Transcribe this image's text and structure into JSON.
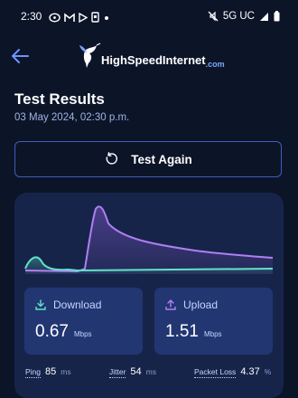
{
  "status_bar": {
    "time": "2:30",
    "network": "5G UC",
    "icons": [
      "whatsapp-icon",
      "gmail-icon",
      "play-store-icon",
      "sim-icon",
      "dot-icon",
      "mute-icon",
      "signal-icon",
      "battery-icon"
    ]
  },
  "header": {
    "back_icon": "arrow-left-icon",
    "logo_text": "HighSpeedInternet",
    "logo_suffix": ".com"
  },
  "title": "Test Results",
  "timestamp": "03 May 2024, 02:30 p.m.",
  "test_again": {
    "label": "Test Again",
    "icon": "refresh-icon"
  },
  "results": {
    "download": {
      "label": "Download",
      "value": "0.67",
      "unit": "Mbps",
      "icon": "download-icon"
    },
    "upload": {
      "label": "Upload",
      "value": "1.51",
      "unit": "Mbps",
      "icon": "upload-icon"
    },
    "stats": [
      {
        "label": "Ping",
        "value": "85",
        "unit": "ms"
      },
      {
        "label": "Jitter",
        "value": "54",
        "unit": "ms"
      },
      {
        "label": "Packet Loss",
        "value": "4.37",
        "unit": "%"
      }
    ]
  },
  "colors": {
    "background": "#0c1428",
    "card": "#17244a",
    "metric_card": "#223672",
    "button_border": "#3f5dbd",
    "download_line": "#5fe3c6",
    "upload_line": "#b07ff2",
    "accent": "#7aa7ff"
  }
}
